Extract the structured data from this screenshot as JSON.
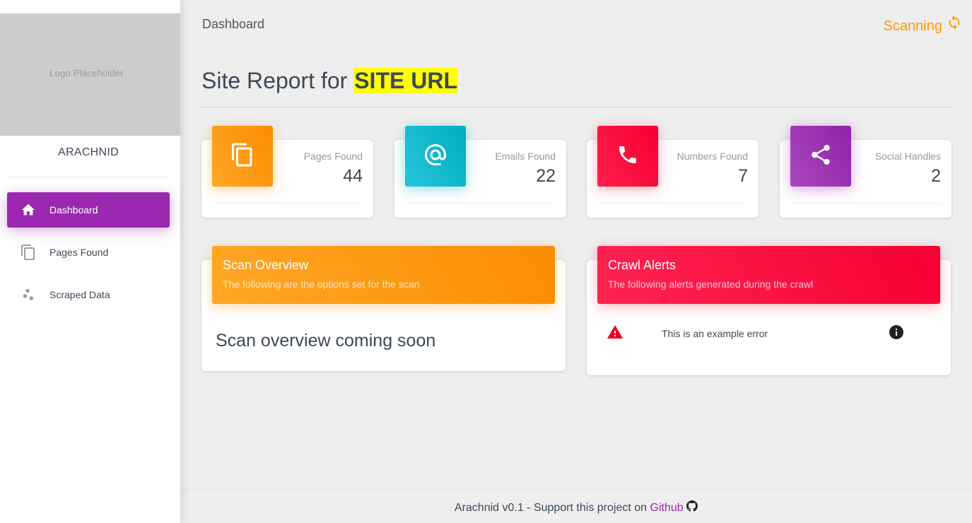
{
  "sidebar": {
    "logo_text": "Logo Placeholder",
    "brand": "ARACHNID",
    "items": [
      {
        "label": "Dashboard",
        "icon": "home-icon",
        "active": true
      },
      {
        "label": "Pages Found",
        "icon": "copy-pages-icon",
        "active": false
      },
      {
        "label": "Scraped Data",
        "icon": "scatter-dots-icon",
        "active": false
      }
    ]
  },
  "topbar": {
    "title": "Dashboard",
    "status": "Scanning",
    "status_icon": "sync-icon",
    "status_color": "#ff9800"
  },
  "page": {
    "title_prefix": "Site Report for",
    "site_url": "SITE URL",
    "highlight_color": "#ffff00"
  },
  "stats": [
    {
      "label": "Pages Found",
      "value": "44",
      "icon": "copy-pages-icon",
      "color": "#fb8c00"
    },
    {
      "label": "Emails Found",
      "value": "22",
      "icon": "at-sign-icon",
      "color": "#00acc1"
    },
    {
      "label": "Numbers Found",
      "value": "7",
      "icon": "phone-icon",
      "color": "#f50031"
    },
    {
      "label": "Social Handles",
      "value": "2",
      "icon": "share-icon",
      "color": "#9c27b0"
    }
  ],
  "scan_overview": {
    "title": "Scan Overview",
    "subtitle": "The following are the options set for the scan",
    "body": "Scan overview coming soon"
  },
  "crawl_alerts": {
    "title": "Crawl Alerts",
    "subtitle": "The following alerts generated during the crawl",
    "alerts": [
      {
        "text": "This is an example error",
        "icon": "warning-icon",
        "action_icon": "info-icon"
      }
    ]
  },
  "footer": {
    "text": "Arachnid v0.1 - Support this project on",
    "link_label": "Github",
    "link_icon": "github-icon"
  }
}
